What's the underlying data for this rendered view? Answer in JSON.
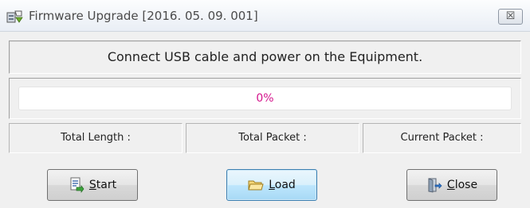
{
  "window": {
    "title": "Firmware Upgrade [2016. 05. 09. 001]",
    "close_glyph": "☒",
    "app_icon": "firmware-icon"
  },
  "message": "Connect USB cable and power on the Equipment.",
  "progress": {
    "value": 0,
    "text": "0%",
    "text_color": "#d4148c"
  },
  "stats": {
    "total_length_label": "Total Length :",
    "total_packet_label": "Total Packet :",
    "current_packet_label": "Current Packet :"
  },
  "buttons": {
    "start": {
      "accel": "S",
      "rest": "tart",
      "icon": "document-arrow-icon"
    },
    "load": {
      "accel": "L",
      "rest": "oad",
      "icon": "folder-open-icon"
    },
    "close": {
      "accel": "C",
      "rest": "lose",
      "icon": "exit-door-icon"
    }
  }
}
